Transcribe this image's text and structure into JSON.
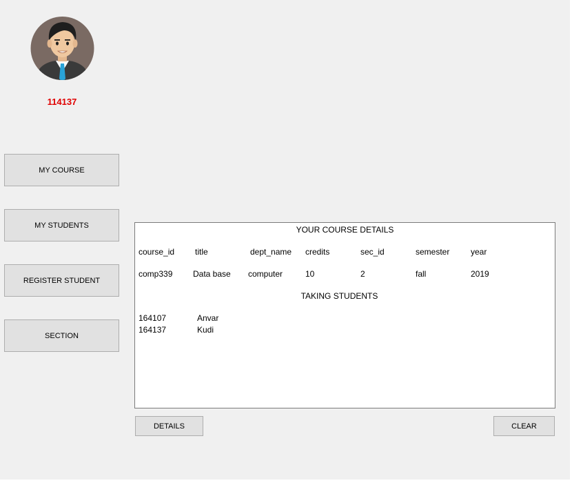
{
  "user": {
    "id": "114137",
    "avatar_icon": "user-avatar-icon"
  },
  "sidebar": {
    "buttons": [
      {
        "label": "MY COURSE"
      },
      {
        "label": "MY STUDENTS"
      },
      {
        "label": "REGISTER STUDENT"
      },
      {
        "label": "SECTION"
      }
    ]
  },
  "details": {
    "course_title": "YOUR COURSE DETAILS",
    "headers": [
      "course_id",
      "title",
      "dept_name",
      "credits",
      "sec_id",
      "semester",
      "year"
    ],
    "row": [
      "comp339",
      "Data base",
      "computer",
      "10",
      "2",
      "fall",
      "2019"
    ],
    "students_title": "TAKING STUDENTS",
    "students": [
      {
        "id": "164107",
        "name": "Anvar"
      },
      {
        "id": "164137",
        "name": "Kudi"
      }
    ]
  },
  "actions": {
    "details_label": "DETAILS",
    "clear_label": "CLEAR"
  },
  "colors": {
    "user_id": "#e00000",
    "background": "#f0f0f0",
    "button": "#e1e1e1"
  }
}
